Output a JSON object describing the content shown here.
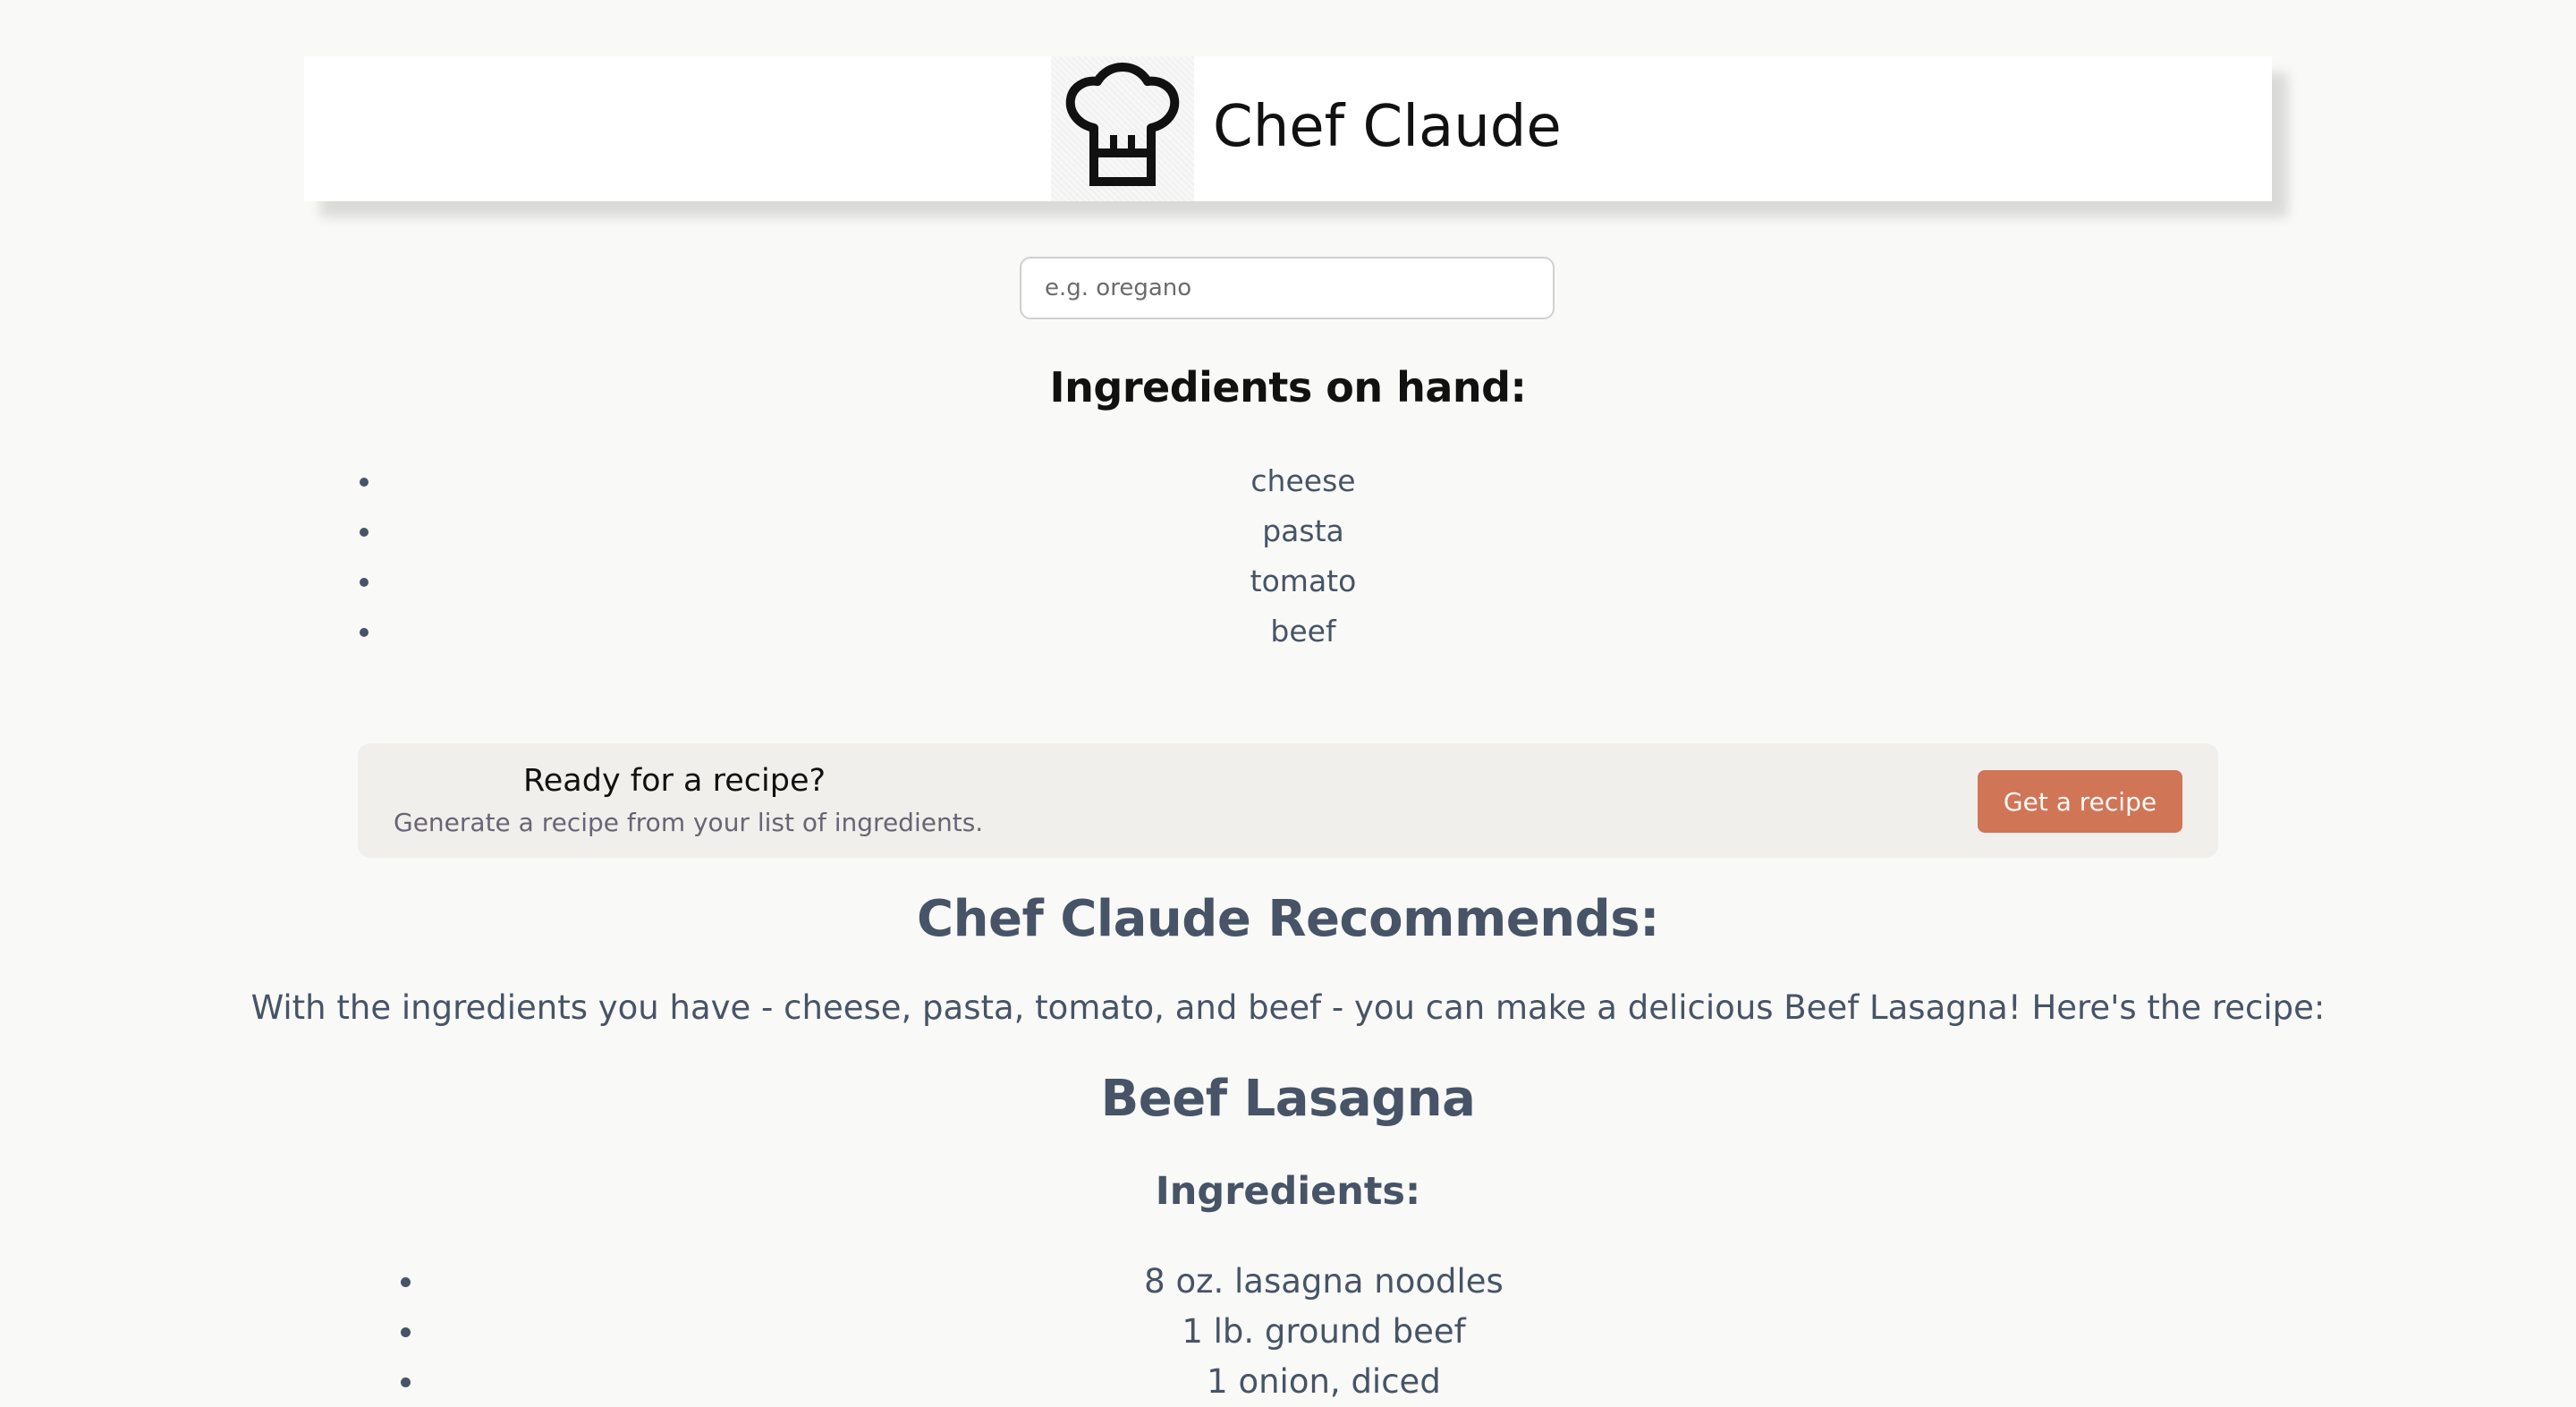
{
  "header": {
    "title": "Chef Claude",
    "logo_icon": "chef-hat-icon"
  },
  "search": {
    "placeholder": "e.g. oregano",
    "value": ""
  },
  "ingredients_on_hand": {
    "heading": "Ingredients on hand:",
    "items": [
      "cheese",
      "pasta",
      "tomato",
      "beef"
    ]
  },
  "cta": {
    "title": "Ready for a recipe?",
    "subtitle": "Generate a recipe from your list of ingredients.",
    "button_label": "Get a recipe",
    "button_color": "#d17557"
  },
  "recommendation": {
    "heading": "Chef Claude Recommends:",
    "intro": "With the ingredients you have - cheese, pasta, tomato, and beef - you can make a delicious Beef Lasagna! Here's the recipe:",
    "recipe_title": "Beef Lasagna",
    "ingredients_heading": "Ingredients:",
    "ingredients": [
      "8 oz. lasagna noodles",
      "1 lb. ground beef",
      "1 onion, diced"
    ]
  }
}
